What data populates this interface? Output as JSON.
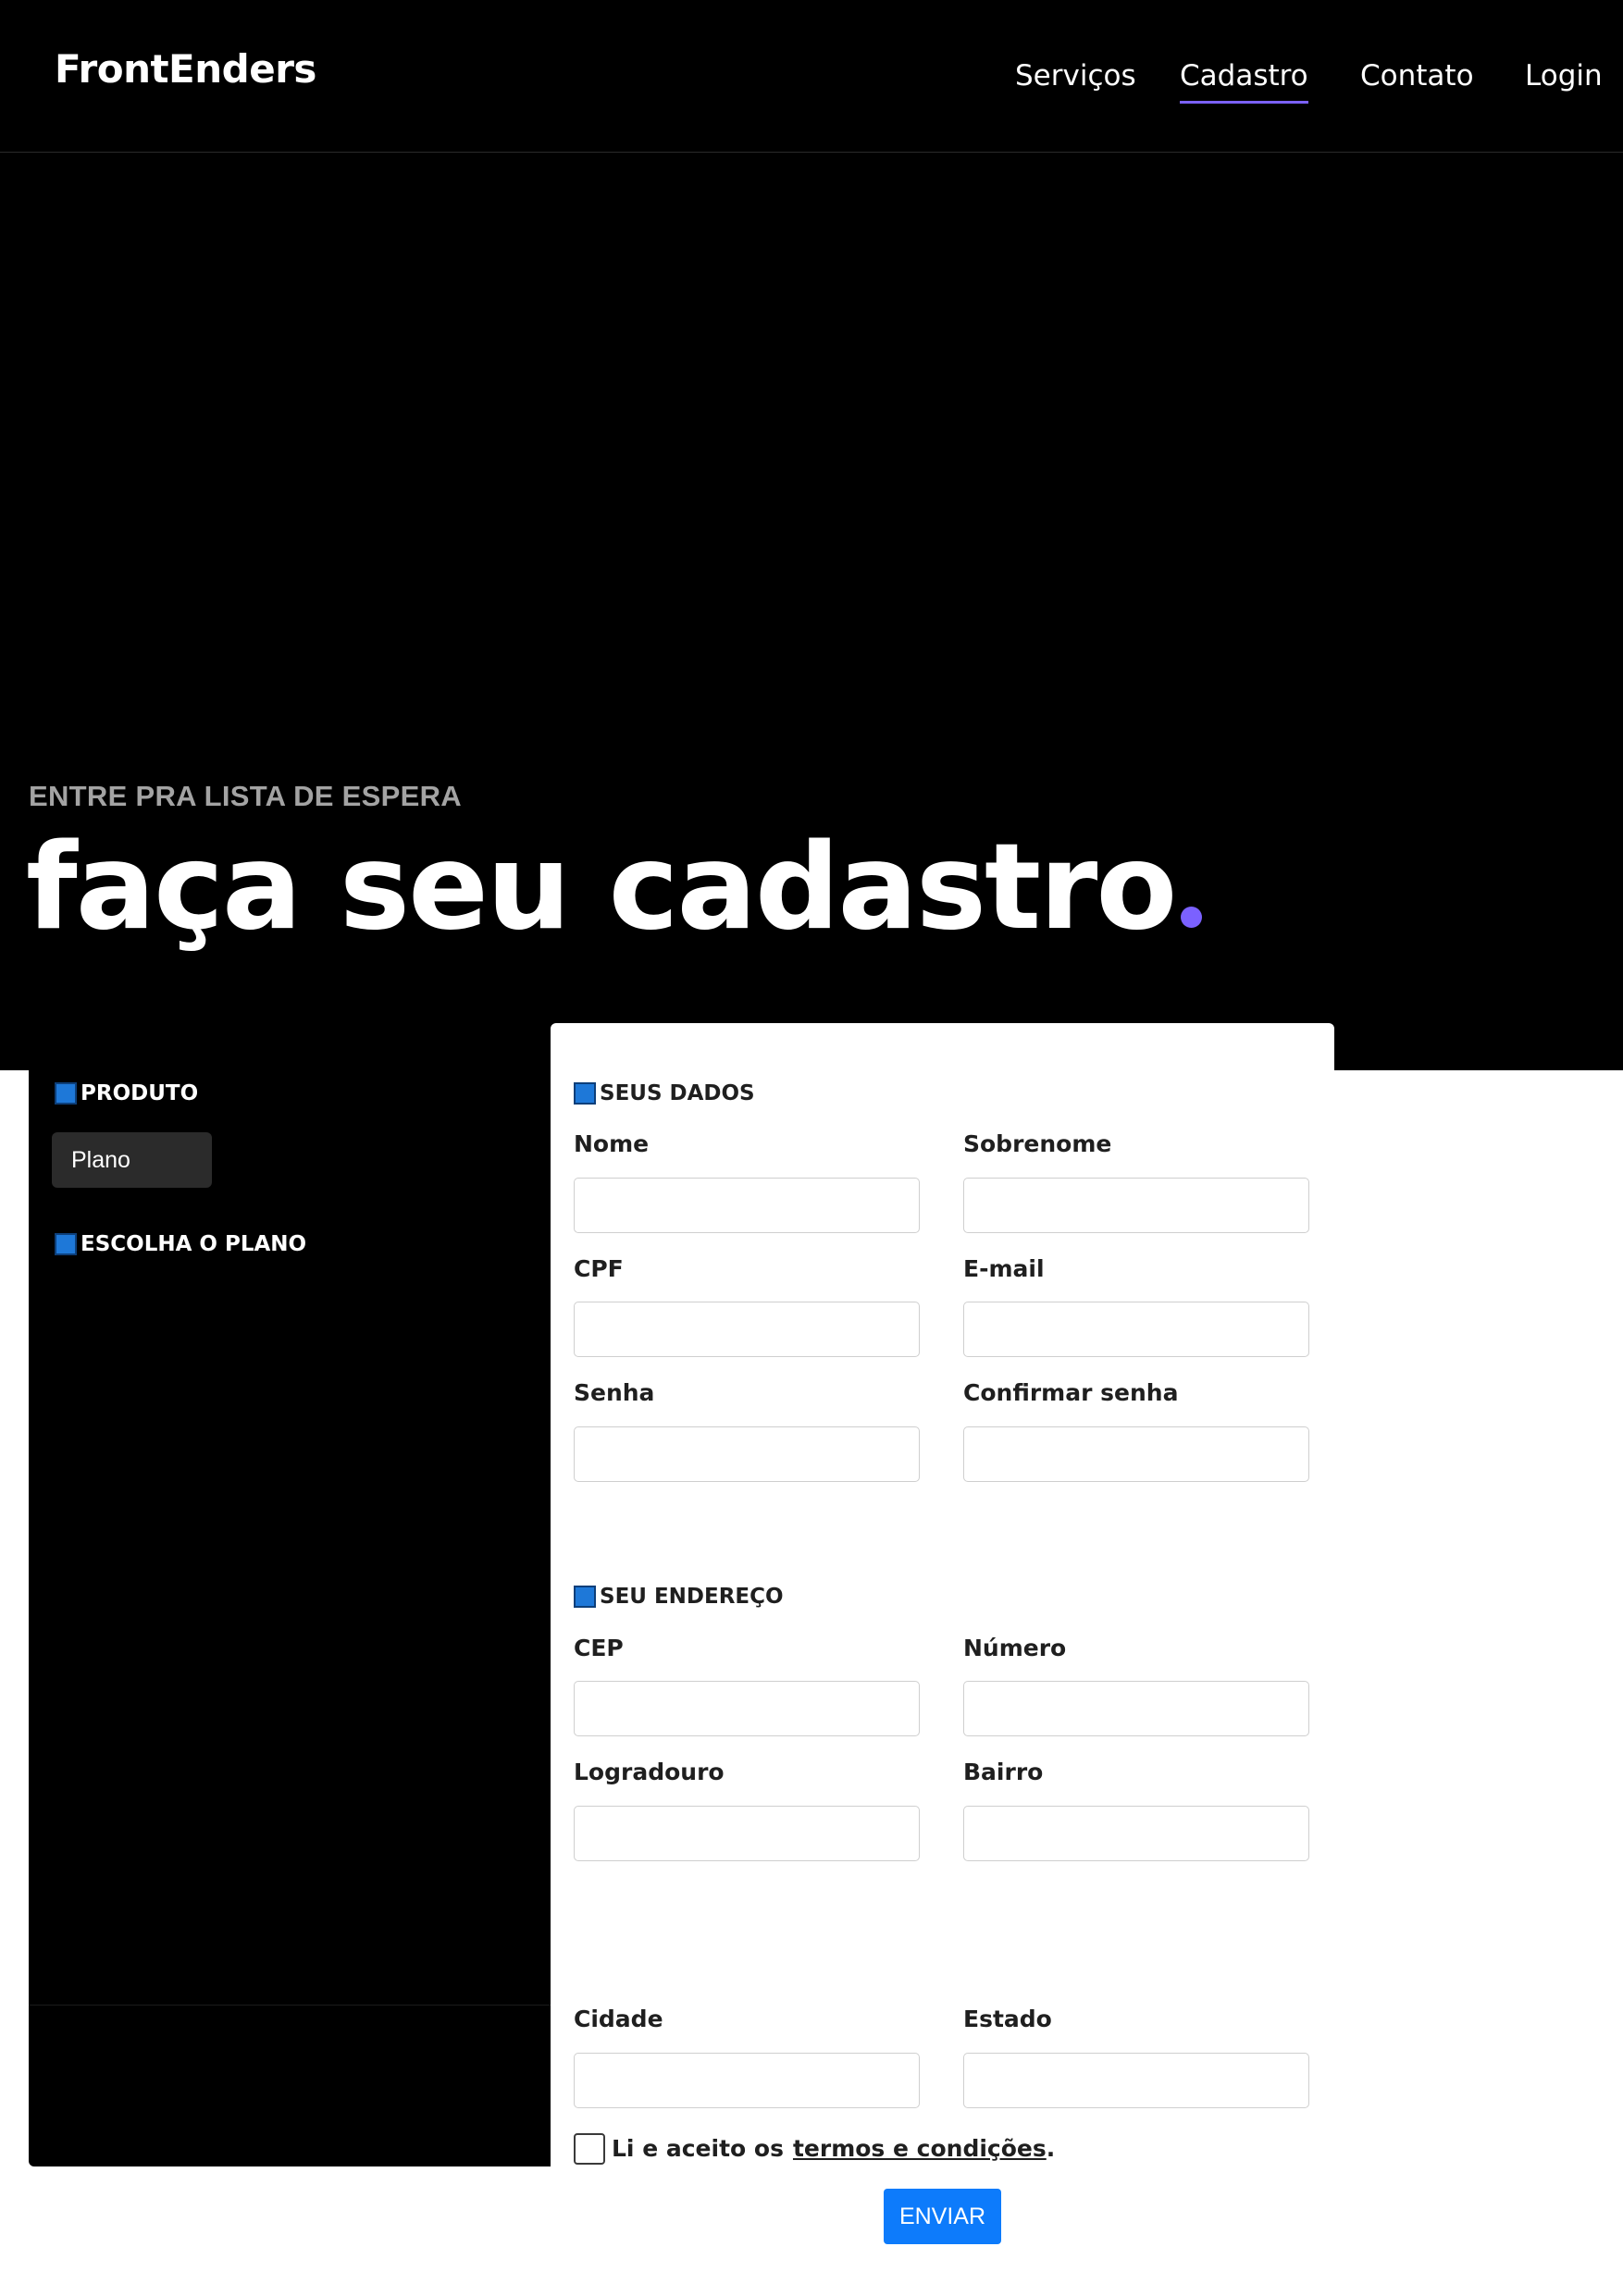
{
  "header": {
    "brand": "FrontEnders",
    "nav": [
      {
        "label": "Serviços",
        "active": false
      },
      {
        "label": "Cadastro",
        "active": true
      },
      {
        "label": "Contato",
        "active": false
      },
      {
        "label": "Login",
        "active": false
      }
    ]
  },
  "hero": {
    "eyebrow": "ENTRE PRA LISTA DE ESPERA",
    "title": "faça seu cadastro",
    "title_dot": "."
  },
  "product_panel": {
    "product_heading": "PRODUTO",
    "plan_select_value": "Plano",
    "choose_plan_heading": "ESCOLHA O PLANO"
  },
  "form": {
    "personal_heading": "SEUS DADOS",
    "fields": {
      "nome": {
        "label": "Nome",
        "value": ""
      },
      "sobrenome": {
        "label": "Sobrenome",
        "value": ""
      },
      "cpf": {
        "label": "CPF",
        "value": ""
      },
      "email": {
        "label": "E-mail",
        "value": ""
      },
      "senha": {
        "label": "Senha",
        "value": ""
      },
      "confirmar_senha": {
        "label": "Confirmar senha",
        "value": ""
      },
      "cep": {
        "label": "CEP",
        "value": ""
      },
      "numero": {
        "label": "Número",
        "value": ""
      },
      "logradouro": {
        "label": "Logradouro",
        "value": ""
      },
      "bairro": {
        "label": "Bairro",
        "value": ""
      },
      "cidade": {
        "label": "Cidade",
        "value": ""
      },
      "estado": {
        "label": "Estado",
        "value": ""
      }
    },
    "address_heading": "SEU ENDEREÇO",
    "terms_prefix": "Li e aceito os",
    "terms_link": "termos e condições",
    "terms_suffix": ".",
    "submit_label": "ENVIAR"
  },
  "colors": {
    "background_dark": "#000000",
    "accent_purple": "#7b61ff",
    "icon_blue": "#1e78d8",
    "button_blue": "#0d7bfb"
  },
  "icons": {
    "section_marker": "blue-square-icon"
  }
}
